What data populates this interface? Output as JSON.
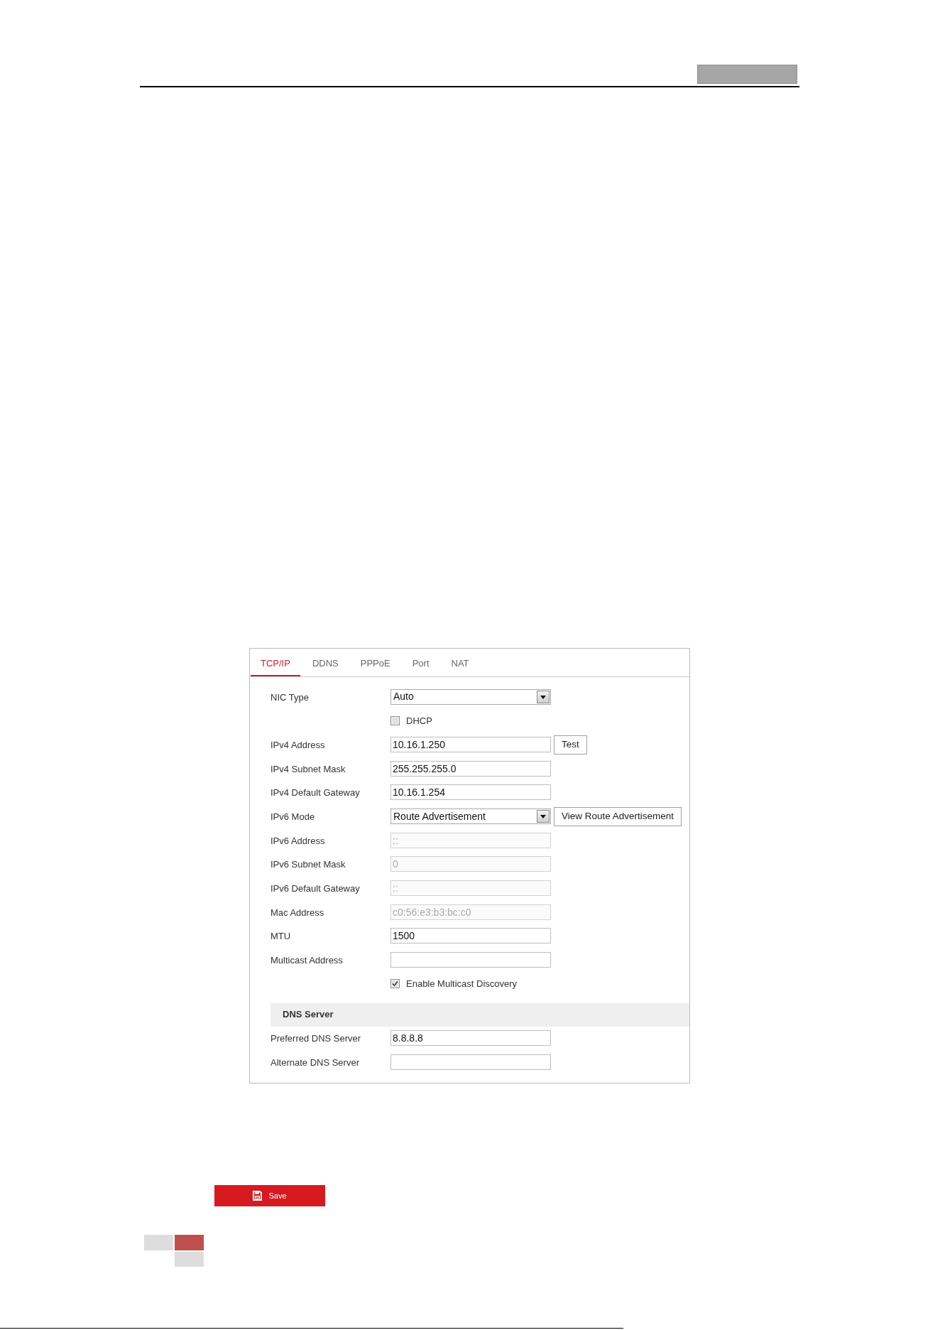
{
  "panel": {
    "tabs": [
      {
        "label": "TCP/IP",
        "selected": true
      },
      {
        "label": "DDNS",
        "selected": false
      },
      {
        "label": "PPPoE",
        "selected": false
      },
      {
        "label": "Port",
        "selected": false
      },
      {
        "label": "NAT",
        "selected": false
      }
    ],
    "rows": [
      {
        "kind": "select",
        "label": "NIC Type",
        "value": "Auto",
        "disabled": false
      },
      {
        "kind": "checkbox",
        "label": "DHCP",
        "checked": false,
        "disabled": false
      },
      {
        "kind": "text",
        "label": "IPv4 Address",
        "value": "10.16.1.250",
        "button": "Test",
        "disabled": false
      },
      {
        "kind": "text",
        "label": "IPv4 Subnet Mask",
        "value": "255.255.255.0",
        "disabled": false
      },
      {
        "kind": "text",
        "label": "IPv4 Default Gateway",
        "value": "10.16.1.254",
        "disabled": false
      },
      {
        "kind": "select",
        "label": "IPv6 Mode",
        "value": "Route Advertisement",
        "button": "View Route Advertisement",
        "disabled": false
      },
      {
        "kind": "text",
        "label": "IPv6 Address",
        "value": "::",
        "disabled": true
      },
      {
        "kind": "text",
        "label": "IPv6 Subnet Mask",
        "value": "0",
        "disabled": true
      },
      {
        "kind": "text",
        "label": "IPv6 Default Gateway",
        "value": "::",
        "disabled": true
      },
      {
        "kind": "text",
        "label": "Mac Address",
        "value": "c0:56:e3:b3:bc:c0",
        "disabled": true
      },
      {
        "kind": "text",
        "label": "MTU",
        "value": "1500",
        "disabled": false
      },
      {
        "kind": "text",
        "label": "Multicast Address",
        "disabled": false
      },
      {
        "kind": "checkbox",
        "label": "Enable Multicast Discovery",
        "checked": true,
        "disabled": false
      }
    ],
    "dns_section": {
      "title": "DNS Server",
      "rows": [
        {
          "kind": "text",
          "label": "Preferred DNS Server",
          "value": "8.8.8.8",
          "disabled": false
        },
        {
          "kind": "text",
          "label": "Alternate DNS Server",
          "disabled": false
        }
      ]
    }
  },
  "save_button": {
    "label": "Save"
  }
}
